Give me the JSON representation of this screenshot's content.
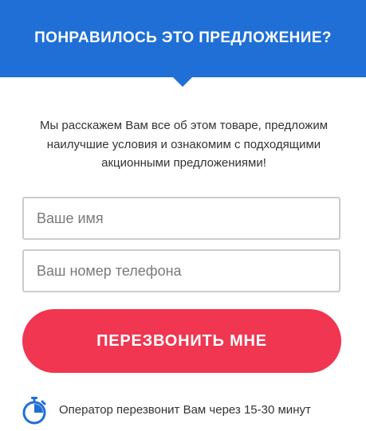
{
  "header": {
    "title": "ПОНРАВИЛОСЬ ЭТО ПРЕДЛОЖЕНИЕ?"
  },
  "intro": {
    "line1": "Мы расскажем Вам все об этом товаре, предложим",
    "line2": "наилучшие условия и ознакомим с подходящими",
    "line3": "акционными предложениями!"
  },
  "form": {
    "name_placeholder": "Ваше имя",
    "name_value": "",
    "phone_placeholder": "Ваш номер телефона",
    "phone_value": "",
    "submit_label": "ПЕРЕЗВОНИТЬ МНЕ"
  },
  "footer": {
    "note": "Оператор перезвонит Вам через 15-30 минут",
    "icon": "stopwatch-icon"
  },
  "colors": {
    "header_background": "#1f6fd6",
    "button_background": "#f03650",
    "icon_color": "#1f6fd6"
  }
}
